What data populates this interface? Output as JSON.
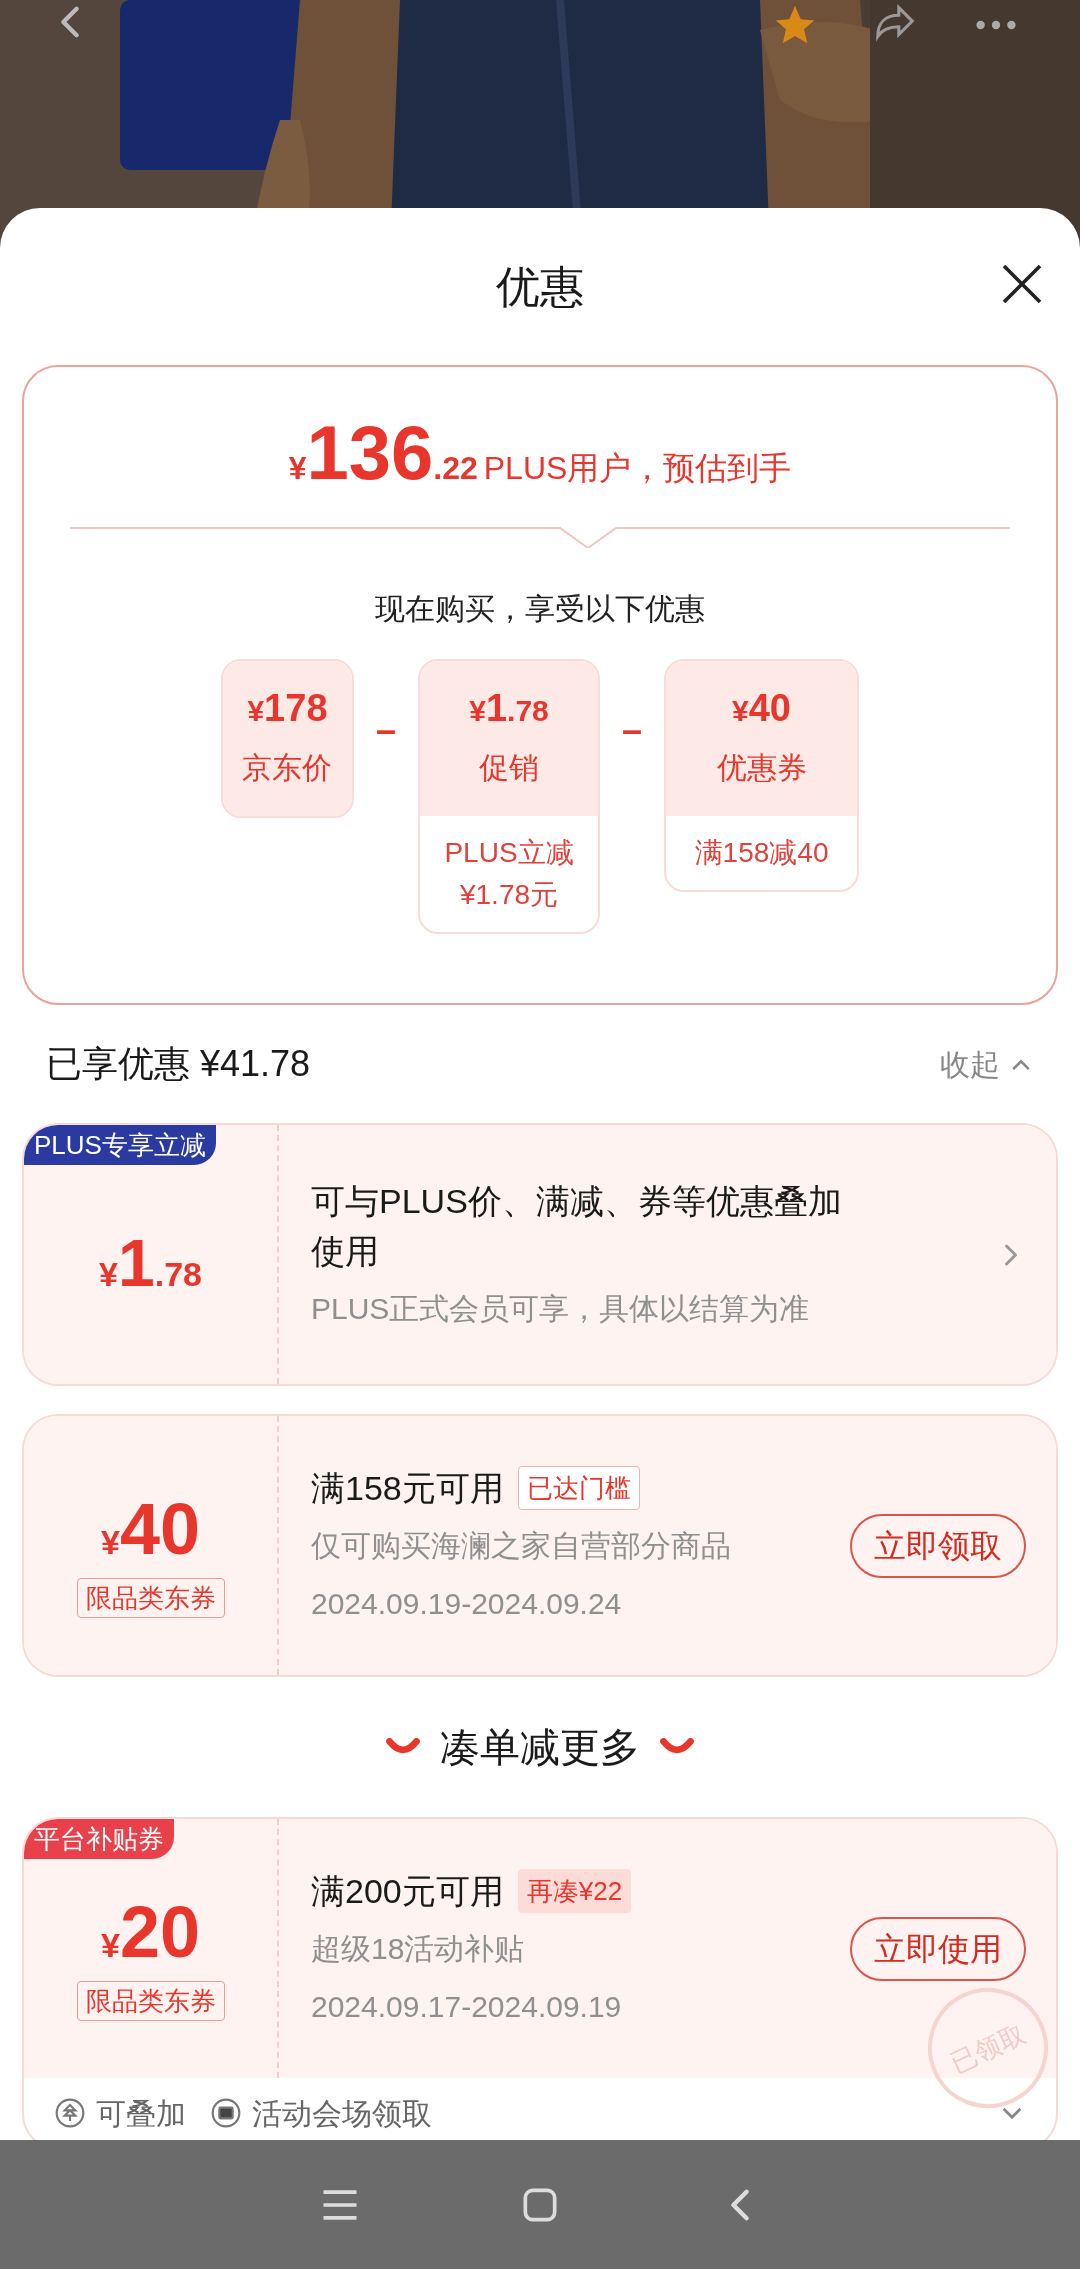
{
  "header": {
    "title": "优惠"
  },
  "estimate": {
    "currency": "¥",
    "integer": "136",
    "decimal": ".22",
    "label": "PLUS用户，预估到手"
  },
  "breakdown": {
    "heading": "现在购买，享受以下优惠",
    "items": [
      {
        "currency": "¥",
        "amount": "178",
        "label": "京东价"
      },
      {
        "currency": "¥",
        "amount": "1",
        "decimal": ".78",
        "label": "促销",
        "details": [
          "PLUS立减",
          "¥1.78元"
        ]
      },
      {
        "currency": "¥",
        "amount": "40",
        "label": "优惠券",
        "details": [
          "满158减40"
        ]
      }
    ],
    "operators": [
      "–",
      "–"
    ]
  },
  "savings": {
    "label": "已享优惠 ¥41.78",
    "toggle": "收起",
    "expanded": true
  },
  "coupons": [
    {
      "kind": "discount",
      "tag": "PLUS专享立减",
      "color": "#2b3aa0",
      "currency": "¥",
      "amount": "1",
      "decimal": ".78",
      "title": "可与PLUS价、满减、券等优惠叠加使用",
      "description": "PLUS正式会员可享，具体以结算为准"
    },
    {
      "kind": "coupon",
      "currency": "¥",
      "amount": "40",
      "type": "限品类东券",
      "title": "满158元可用",
      "badge": {
        "text": "已达门槛",
        "kind": "outline"
      },
      "description": "仅可购买海澜之家自营部分商品",
      "dates": "2024.09.19-2024.09.24",
      "button": "立即领取"
    }
  ],
  "more": {
    "heading": "凑单减更多",
    "coupons": [
      {
        "kind": "coupon",
        "tag": "平台补贴券",
        "color": "#e8414b",
        "currency": "¥",
        "amount": "20",
        "type": "限品类东券",
        "title": "满200元可用",
        "badge": {
          "text": "再凑¥22",
          "kind": "filled"
        },
        "description": "超级18活动补贴",
        "dates": "2024.09.17-2024.09.19",
        "button": "立即使用",
        "stamp": "已领取",
        "features": [
          "可叠加",
          "活动会场领取"
        ],
        "expanded": false
      }
    ]
  }
}
